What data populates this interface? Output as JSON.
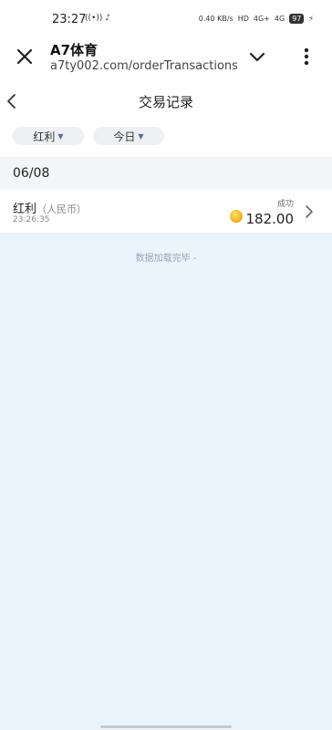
{
  "status_bar": {
    "time": "23:27",
    "left_icons": "((•)) ♪",
    "right_icons": [
      "0.40 KB/s",
      "HD",
      "4G+",
      "4G"
    ],
    "battery": "97"
  },
  "browser": {
    "title": "A7体育",
    "url": "a7ty002.com/orderTransactions?"
  },
  "page": {
    "title": "交易记录"
  },
  "filters": {
    "type_label": "红利",
    "date_label": "今日"
  },
  "records": {
    "date": "06/08",
    "items": [
      {
        "type": "红利",
        "currency": "（人民币）",
        "time": "23:26:35",
        "status": "成功",
        "amount": "182.00"
      }
    ]
  },
  "footer": {
    "load_complete": "数据加载完毕 -"
  },
  "colors": {
    "content_background": "#e9f4fc",
    "chip_background": "#eef0f3",
    "coin": "#f3b21d"
  }
}
